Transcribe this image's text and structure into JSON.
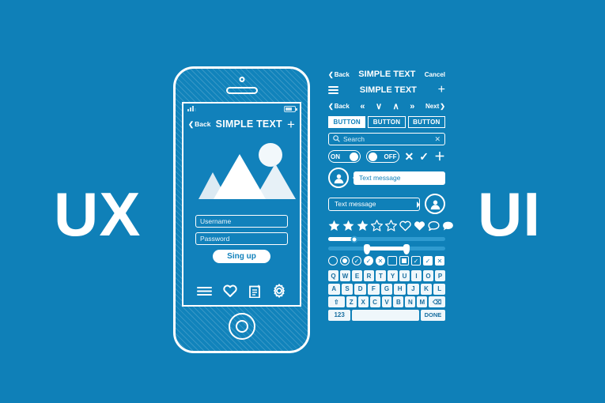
{
  "theme": {
    "background": "#0f80b8",
    "ink": "#ffffff",
    "screen_bg": "#1181bb",
    "key_bg": "#eff7fb",
    "key_ink": "#1a6fa0"
  },
  "words": {
    "left": "UX",
    "right": "UI"
  },
  "phone": {
    "status": {
      "signal_icon": "signal-bars-icon",
      "battery_icon": "battery-icon"
    },
    "navbar": {
      "back_label": "Back",
      "title": "SIMPLE TEXT",
      "add_label": "+"
    },
    "hero": {
      "image_icon": "mountains-image-icon",
      "sun_icon": "sun-icon"
    },
    "form": {
      "username_placeholder": "Username",
      "password_placeholder": "Password",
      "submit_label": "Sing up"
    },
    "tabbar": [
      {
        "icon": "menu-icon",
        "label": "Menu"
      },
      {
        "icon": "heart-icon",
        "label": "Favorites"
      },
      {
        "icon": "note-add-icon",
        "label": "New note"
      },
      {
        "icon": "gear-icon",
        "label": "Settings"
      }
    ],
    "home_button_icon": "home-button-icon"
  },
  "kit": {
    "navbar_a": {
      "back_label": "Back",
      "title": "SIMPLE TEXT",
      "cancel_label": "Cancel"
    },
    "navbar_b": {
      "menu_icon": "hamburger-icon",
      "title": "SIMPLE TEXT",
      "add_label": "+"
    },
    "pager": {
      "back_label": "Back",
      "first_label": "«",
      "down_label": "∨",
      "up_label": "∧",
      "last_label": "»",
      "next_label": "Next"
    },
    "buttons": [
      {
        "label": "BUTTON",
        "state": "selected"
      },
      {
        "label": "BUTTON",
        "state": "normal"
      },
      {
        "label": "BUTTON",
        "state": "normal"
      }
    ],
    "search": {
      "placeholder": "Search",
      "icon": "search-icon",
      "clear_icon": "clear-icon"
    },
    "toggles": [
      {
        "label": "ON",
        "state": "on"
      },
      {
        "label": "OFF",
        "state": "off"
      }
    ],
    "action_symbols": [
      {
        "icon": "close-icon",
        "glyph": "✕"
      },
      {
        "icon": "check-icon",
        "glyph": "✓"
      },
      {
        "icon": "plus-icon",
        "glyph": "＋"
      }
    ],
    "messages": [
      {
        "avatar_icon": "user-avatar-icon",
        "text": "Text message",
        "side": "left",
        "style": "filled"
      },
      {
        "avatar_icon": "user-avatar-icon",
        "text": "Text message",
        "side": "right",
        "style": "outlined"
      }
    ],
    "rating": {
      "stars_filled": 3,
      "stars_total": 5,
      "extra_icons": [
        {
          "icon": "heart-outline-icon"
        },
        {
          "icon": "heart-filled-icon"
        },
        {
          "icon": "chat-outline-icon"
        },
        {
          "icon": "chat-filled-icon"
        }
      ]
    },
    "sliders": [
      {
        "name": "single-slider",
        "value_pct": 22,
        "handle": "circle"
      },
      {
        "name": "range-slider",
        "low_pct": 33,
        "high_pct": 67,
        "handle": "pin"
      }
    ],
    "controls": [
      {
        "icon": "radio-empty-icon",
        "glyph": ""
      },
      {
        "icon": "radio-selected-icon",
        "glyph": ""
      },
      {
        "icon": "radio-check-outline-icon",
        "glyph": "✓"
      },
      {
        "icon": "radio-check-filled-icon",
        "glyph": "✓"
      },
      {
        "icon": "radio-close-filled-icon",
        "glyph": "✕"
      },
      {
        "icon": "checkbox-empty-icon",
        "glyph": ""
      },
      {
        "icon": "checkbox-filled-icon",
        "glyph": ""
      },
      {
        "icon": "checkbox-checked-icon",
        "glyph": "✓"
      },
      {
        "icon": "check-plain-icon",
        "glyph": "✓"
      },
      {
        "icon": "close-plain-icon",
        "glyph": "✕"
      }
    ],
    "keyboard": {
      "row1": [
        "Q",
        "W",
        "E",
        "R",
        "T",
        "Y",
        "U",
        "I",
        "O",
        "P"
      ],
      "row2": [
        "A",
        "S",
        "D",
        "F",
        "G",
        "H",
        "J",
        "K",
        "L"
      ],
      "row3": [
        "Z",
        "X",
        "C",
        "V",
        "B",
        "N",
        "M"
      ],
      "shift_label": "⇧",
      "backspace_label": "⌫",
      "numeric_label": "123",
      "space_label": "",
      "done_label": "DONE"
    }
  }
}
